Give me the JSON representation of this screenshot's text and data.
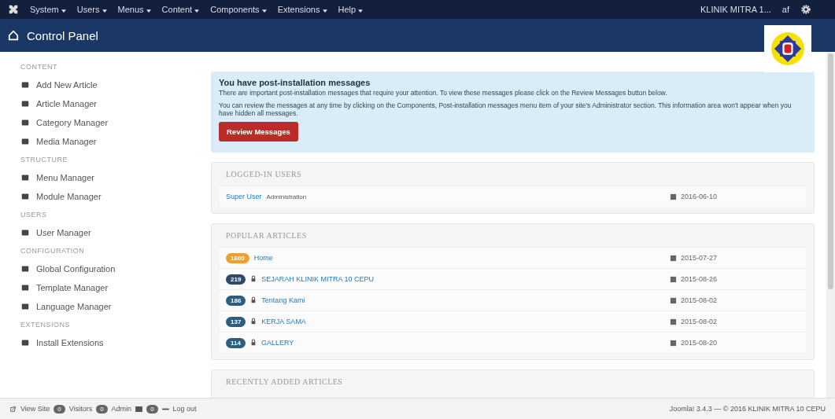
{
  "topbar": {
    "menus": [
      "System",
      "Users",
      "Menus",
      "Content",
      "Components",
      "Extensions",
      "Help"
    ],
    "site": "KLINIK MITRA 1...",
    "site_suffix": "af"
  },
  "header": {
    "title": "Control Panel"
  },
  "sidebar": [
    {
      "heading": "CONTENT",
      "items": [
        "Add New Article",
        "Article Manager",
        "Category Manager",
        "Media Manager"
      ]
    },
    {
      "heading": "STRUCTURE",
      "items": [
        "Menu Manager",
        "Module Manager"
      ]
    },
    {
      "heading": "USERS",
      "items": [
        "User Manager"
      ]
    },
    {
      "heading": "CONFIGURATION",
      "items": [
        "Global Configuration",
        "Template Manager",
        "Language Manager"
      ]
    },
    {
      "heading": "EXTENSIONS",
      "items": [
        "Install Extensions"
      ]
    }
  ],
  "notice": {
    "title": "You have post-installation messages",
    "text1": "There are important post-installation messages that require your attention. To view these messages please click on the Review Messages button below.",
    "text2": "You can review the messages at any time by clicking on the Components, Post-installation messages menu item of your site's Administrator section. This information area won't appear when you have hidden all messages.",
    "button": "Review Messages"
  },
  "logged_users": {
    "heading": "LOGGED-IN USERS",
    "rows": [
      {
        "name": "Super User",
        "role": "Administration",
        "date": "2016-06-10"
      }
    ]
  },
  "popular_articles": {
    "heading": "POPULAR ARTICLES",
    "rows": [
      {
        "hits": "1600",
        "color": "#f0a030",
        "locked": false,
        "title": "Home",
        "date": "2015-07-27"
      },
      {
        "hits": "219",
        "color": "#2d4a6e",
        "locked": true,
        "title": "SEJARAH KLINIK MITRA 10 CEPU",
        "date": "2015-08-26"
      },
      {
        "hits": "186",
        "color": "#2d5e80",
        "locked": true,
        "title": "Tentang Kami",
        "date": "2015-08-02"
      },
      {
        "hits": "137",
        "color": "#2d5e80",
        "locked": true,
        "title": "KERJA SAMA",
        "date": "2015-08-02"
      },
      {
        "hits": "114",
        "color": "#2d5e80",
        "locked": true,
        "title": "GALLERY",
        "date": "2015-08-20"
      }
    ]
  },
  "recent_articles": {
    "heading": "RECENTLY ADDED ARTICLES"
  },
  "status_bar": {
    "view_site": "View Site",
    "visitors": "0",
    "visitors_label": "Visitors",
    "admins": "0",
    "admins_label": "Admin",
    "messages": "0",
    "logout": "Log out",
    "footer": "Joomla! 3.4.3 — © 2016 KLINIK MITRA 10 CEPU"
  }
}
